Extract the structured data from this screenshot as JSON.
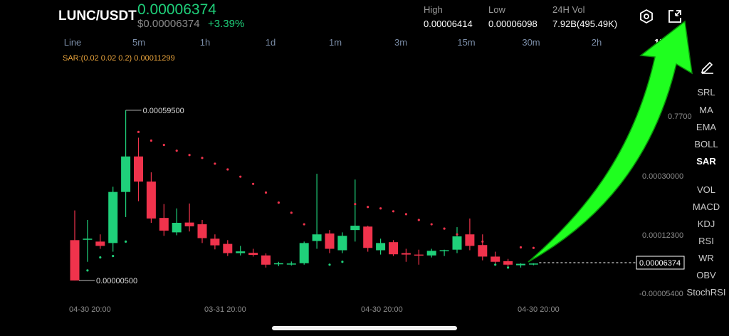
{
  "header": {
    "pair": "LUNC/USDT",
    "last_price": "0.00006374",
    "usd_price": "$0.00006374",
    "change_pct": "+3.39%",
    "high_label": "High",
    "high_value": "0.00006414",
    "low_label": "Low",
    "low_value": "0.00006098",
    "vol_label": "24H Vol",
    "vol_value": "7.92B(495.49K)"
  },
  "intervals": {
    "items": [
      "Line",
      "5m",
      "1h",
      "1d",
      "1m",
      "3m",
      "15m",
      "30m",
      "2h",
      "1M"
    ],
    "active": "1M"
  },
  "indicator_line": "SAR:(0.02 0.02 0.2) 0.00011299",
  "side_menu": {
    "items": [
      "SRL",
      "MA",
      "EMA",
      "BOLL",
      "SAR",
      "VOL",
      "MACD",
      "KDJ",
      "RSI",
      "WR",
      "OBV",
      "StochRSI"
    ],
    "active": "SAR"
  },
  "icons": [
    "settings-hexagon-icon",
    "fullscreen-exit-icon",
    "pencil-draw-icon"
  ],
  "colors": {
    "up": "#1fd07a",
    "down": "#f0334c",
    "sar": "#f0334c",
    "arrow": "#1fff1f"
  },
  "chart_data": {
    "type": "candlestick",
    "price_axis_labels": [
      "0.7700",
      "0.00030000",
      "0.00012300",
      "0.00006374",
      "-0.00005400"
    ],
    "current_price_tag": "0.00006374",
    "max_annotation": "0.00059500",
    "min_annotation": "0.00000500",
    "time_labels": [
      "04-30 20:00",
      "03-31 20:00",
      "04-30 20:00",
      "04-30 20:00"
    ],
    "candles": [
      {
        "o": 0.000145,
        "h": 0.000248,
        "l": 5e-06,
        "c": 5e-06
      },
      {
        "o": 0.000148,
        "h": 0.000215,
        "l": 7e-05,
        "c": 0.00015
      },
      {
        "o": 0.00014,
        "h": 0.000165,
        "l": 0.000115,
        "c": 0.000125
      },
      {
        "o": 0.000135,
        "h": 0.00033,
        "l": 0.000105,
        "c": 0.000312
      },
      {
        "o": 0.000312,
        "h": 0.000595,
        "l": 0.000225,
        "c": 0.000435
      },
      {
        "o": 0.000435,
        "h": 0.0005,
        "l": 0.00028,
        "c": 0.000348
      },
      {
        "o": 0.000348,
        "h": 0.00038,
        "l": 0.000205,
        "c": 0.00022
      },
      {
        "o": 0.000222,
        "h": 0.00027,
        "l": 0.00016,
        "c": 0.000178
      },
      {
        "o": 0.000172,
        "h": 0.000255,
        "l": 0.000162,
        "c": 0.000205
      },
      {
        "o": 0.000206,
        "h": 0.000272,
        "l": 0.000175,
        "c": 0.000193
      },
      {
        "o": 0.0002,
        "h": 0.000215,
        "l": 0.000135,
        "c": 0.000152
      },
      {
        "o": 0.00015,
        "h": 0.000165,
        "l": 0.000113,
        "c": 0.000127
      },
      {
        "o": 0.000132,
        "h": 0.000145,
        "l": 9e-05,
        "c": 0.0001
      },
      {
        "o": 0.0001,
        "h": 0.000125,
        "l": 9.2e-05,
        "c": 0.000106
      },
      {
        "o": 0.000101,
        "h": 0.000115,
        "l": 8.8e-05,
        "c": 9.4e-05
      },
      {
        "o": 9.2e-05,
        "h": 9.9e-05,
        "l": 5e-05,
        "c": 6e-05
      },
      {
        "o": 6.2e-05,
        "h": 7e-05,
        "l": 5.5e-05,
        "c": 6.5e-05
      },
      {
        "o": 6.3e-05,
        "h": 7.1e-05,
        "l": 5.7e-05,
        "c": 6.4e-05
      },
      {
        "o": 6.5e-05,
        "h": 0.00014,
        "l": 6e-05,
        "c": 0.000135
      },
      {
        "o": 0.000142,
        "h": 0.000375,
        "l": 0.000115,
        "c": 0.000165
      },
      {
        "o": 0.000168,
        "h": 0.00018,
        "l": 0.0001,
        "c": 0.000115
      },
      {
        "o": 0.00011,
        "h": 0.000172,
        "l": 0.0001,
        "c": 0.00016
      },
      {
        "o": 0.00018,
        "h": 0.000355,
        "l": 0.00014,
        "c": 0.000195
      },
      {
        "o": 0.000192,
        "h": 0.000195,
        "l": 0.000105,
        "c": 0.000118
      },
      {
        "o": 0.00011,
        "h": 0.00015,
        "l": 9.5e-05,
        "c": 0.000135
      },
      {
        "o": 0.000138,
        "h": 0.000145,
        "l": 9e-05,
        "c": 9.6e-05
      },
      {
        "o": 0.0001,
        "h": 0.000115,
        "l": 7e-05,
        "c": 9.5e-05
      },
      {
        "o": 9.5e-05,
        "h": 0.000112,
        "l": 6e-05,
        "c": 9.3e-05
      },
      {
        "o": 9.2e-05,
        "h": 0.000115,
        "l": 8.5e-05,
        "c": 0.000108
      },
      {
        "o": 0.000108,
        "h": 0.000112,
        "l": 9e-05,
        "c": 0.00011
      },
      {
        "o": 0.000112,
        "h": 0.00019,
        "l": 0.0001,
        "c": 0.000158
      },
      {
        "o": 0.000165,
        "h": 0.00022,
        "l": 0.00011,
        "c": 0.000125
      },
      {
        "o": 0.000128,
        "h": 0.000165,
        "l": 7.5e-05,
        "c": 8.8e-05
      },
      {
        "o": 8.8e-05,
        "h": 0.000105,
        "l": 6e-05,
        "c": 7e-05
      },
      {
        "o": 7.2e-05,
        "h": 8e-05,
        "l": 4.8e-05,
        "c": 6e-05
      },
      {
        "o": 5.8e-05,
        "h": 6.5e-05,
        "l": 5e-05,
        "c": 6.3e-05
      },
      {
        "o": 6.2e-05,
        "h": 6.5e-05,
        "l": 5.8e-05,
        "c": 6.4e-05
      }
    ],
    "sar": [
      null,
      4e-05,
      8.5e-05,
      9e-05,
      0.00014,
      0.00052,
      0.00049,
      0.000475,
      0.000455,
      0.00044,
      0.00043,
      0.00041,
      0.00039,
      0.000365,
      0.00034,
      0.00031,
      0.000275,
      0.00024,
      0.0002,
      0.00016,
      6e-05,
      7e-05,
      0.00027,
      0.00026,
      0.000255,
      0.000245,
      0.000235,
      0.000215,
      0.0002,
      0.000185,
      0.000165,
      0.00015,
      0.00014,
      6e-05,
      5e-05,
      0.00012,
      0.000118
    ],
    "ylim": [
      -5.4e-05,
      0.00077
    ]
  }
}
